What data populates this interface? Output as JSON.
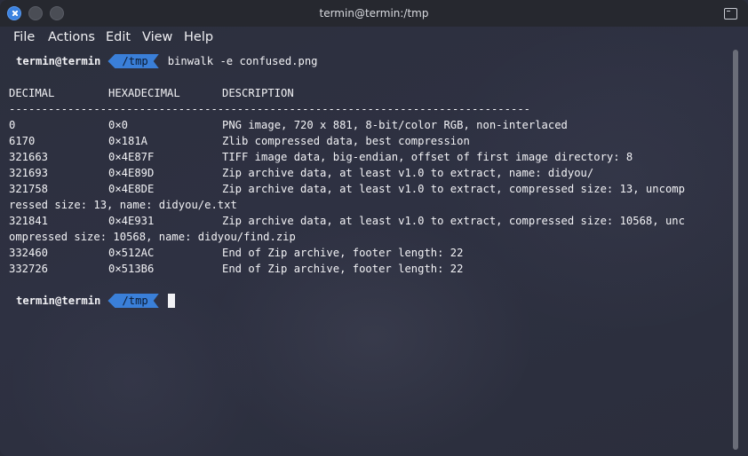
{
  "window": {
    "title": "termin@termin:/tmp"
  },
  "menu": [
    "File",
    "Actions",
    "Edit",
    "View",
    "Help"
  ],
  "prompt": {
    "user": "termin@termin",
    "path": "/tmp",
    "command": "binwalk -e confused.png"
  },
  "table": {
    "headers": [
      "DECIMAL",
      "HEXADECIMAL",
      "DESCRIPTION"
    ],
    "separator": "--------------------------------------------------------------------------------",
    "rows": [
      {
        "decimal": "0",
        "hex": "0×0",
        "description": "PNG image, 720 x 881, 8-bit/color RGB, non-interlaced"
      },
      {
        "decimal": "6170",
        "hex": "0×181A",
        "description": "Zlib compressed data, best compression"
      },
      {
        "decimal": "321663",
        "hex": "0×4E87F",
        "description": "TIFF image data, big-endian, offset of first image directory: 8"
      },
      {
        "decimal": "321693",
        "hex": "0×4E89D",
        "description": "Zip archive data, at least v1.0 to extract, name: didyou/"
      },
      {
        "decimal": "321758",
        "hex": "0×4E8DE",
        "description": "Zip archive data, at least v1.0 to extract, compressed size: 13, uncomp",
        "wrap": "ressed size: 13, name: didyou/e.txt"
      },
      {
        "decimal": "321841",
        "hex": "0×4E931",
        "description": "Zip archive data, at least v1.0 to extract, compressed size: 10568, unc",
        "wrap": "ompressed size: 10568, name: didyou/find.zip"
      },
      {
        "decimal": "332460",
        "hex": "0×512AC",
        "description": "End of Zip archive, footer length: 22"
      },
      {
        "decimal": "332726",
        "hex": "0×513B6",
        "description": "End of Zip archive, footer length: 22"
      }
    ]
  },
  "prompt2": {
    "user": "termin@termin",
    "path": "/tmp"
  }
}
